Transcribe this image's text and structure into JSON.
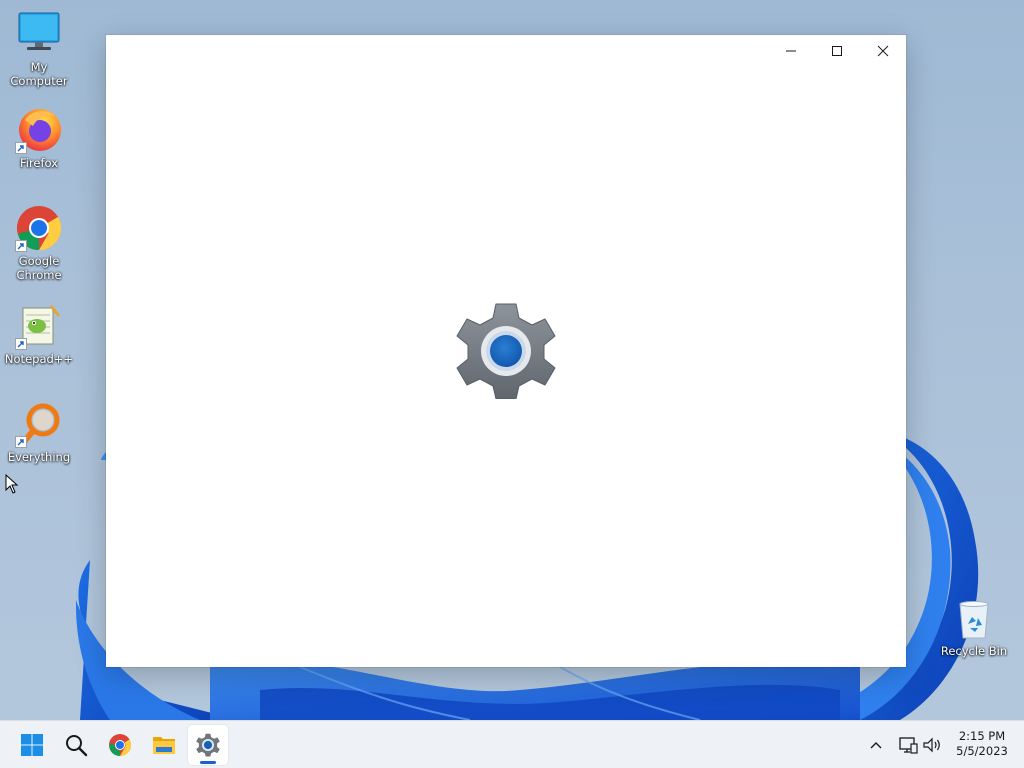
{
  "desktop": {
    "icons": [
      {
        "label": "My Computer",
        "icon": "monitor-icon"
      },
      {
        "label": "Firefox",
        "icon": "firefox-icon"
      },
      {
        "label": "Google Chrome",
        "icon": "chrome-icon"
      },
      {
        "label": "Notepad++",
        "icon": "notepadpp-icon"
      },
      {
        "label": "Everything",
        "icon": "everything-search-icon"
      },
      {
        "label": "Recycle Bin",
        "icon": "recycle-bin-icon"
      }
    ]
  },
  "window": {
    "app_icon": "settings-gear-icon",
    "controls": [
      "minimize",
      "maximize",
      "close"
    ]
  },
  "taskbar": {
    "items": [
      {
        "name": "start",
        "icon": "windows-logo-icon"
      },
      {
        "name": "search",
        "icon": "search-icon"
      },
      {
        "name": "chrome",
        "icon": "chrome-icon"
      },
      {
        "name": "file-explorer",
        "icon": "folder-icon"
      },
      {
        "name": "settings",
        "icon": "settings-gear-icon",
        "active": true
      }
    ],
    "tray": [
      "chevron-up-icon",
      "network-icon",
      "volume-icon"
    ],
    "clock": {
      "time": "2:15 PM",
      "date": "5/5/2023"
    }
  },
  "colors": {
    "accent": "#1b63c6",
    "desktop_bg": "#a9c0d8",
    "taskbar_bg": "#eef1f5",
    "window_bg": "#ffffff"
  }
}
